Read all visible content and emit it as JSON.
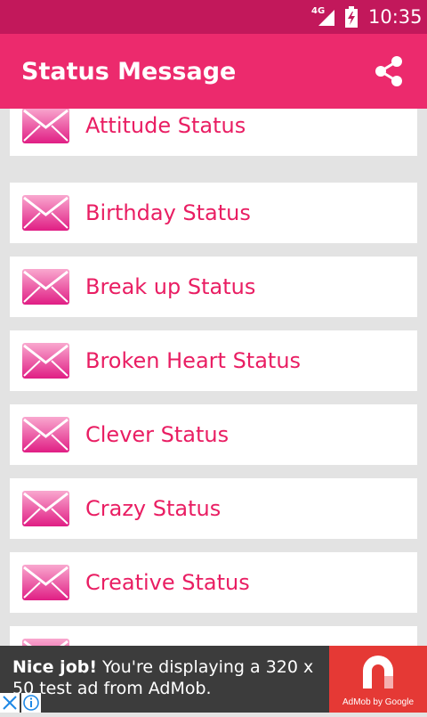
{
  "status_bar": {
    "network": "4G",
    "time": "10:35"
  },
  "app_bar": {
    "title": "Status Message",
    "share_icon": "share-icon"
  },
  "list": {
    "items": [
      {
        "label": "Attitude Status",
        "icon": "envelope-icon"
      },
      {
        "label": "Birthday Status",
        "icon": "envelope-icon"
      },
      {
        "label": "Break up Status",
        "icon": "envelope-icon"
      },
      {
        "label": "Broken Heart Status",
        "icon": "envelope-icon"
      },
      {
        "label": "Clever Status",
        "icon": "envelope-icon"
      },
      {
        "label": "Crazy Status",
        "icon": "envelope-icon"
      },
      {
        "label": "Creative Status",
        "icon": "envelope-icon"
      },
      {
        "label": "",
        "icon": "envelope-icon"
      }
    ]
  },
  "ad": {
    "headline": "Nice job!",
    "body": " You're displaying a 320 x 50 test ad from AdMob.",
    "logo_caption": "AdMob by Google"
  },
  "colors": {
    "status_bar": "#c2185b",
    "app_bar": "#ec2a6d",
    "accent_text": "#e91e63",
    "ad_logo_bg": "#e53935"
  }
}
